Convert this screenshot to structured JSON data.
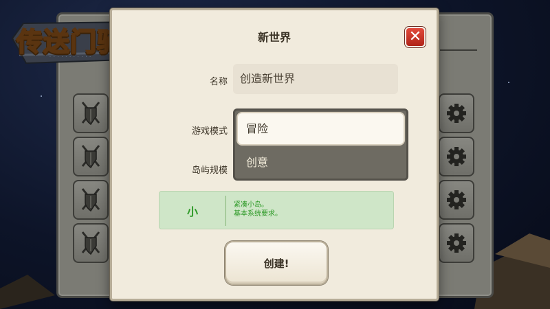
{
  "logo": {
    "title": "传送门骑士",
    "subtitle": "· · ·  · · · ·  · · · ·"
  },
  "dialog": {
    "title": "新世界",
    "close_glyph": "✕"
  },
  "form": {
    "name_label": "名称",
    "name_value": "创造新世界",
    "mode_label": "游戏模式",
    "size_label": "岛屿规模",
    "mode_options": [
      "冒险",
      "创意"
    ],
    "mode_selected": "冒险",
    "size_value": "小",
    "size_desc_line1": "紧凑小岛。",
    "size_desc_line2": "基本系统要求。"
  },
  "create_button": {
    "label": "创建!"
  },
  "world_list": {
    "slot_icon_left": "shield-crossed-swords-icon",
    "slot_icon_right": "gear-icon"
  },
  "colors": {
    "dialog_bg": "#f1ebdd",
    "close_red": "#d13a2c",
    "size_green": "#2e9a28",
    "size_box_bg": "#cfe6c8",
    "back_panel": "#7b7b74"
  }
}
